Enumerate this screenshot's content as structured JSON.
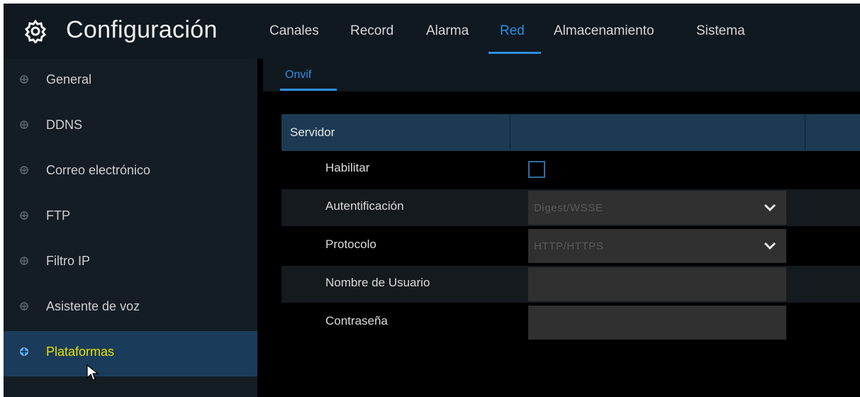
{
  "header": {
    "title": "Configuración",
    "icon": "gear-icon",
    "tabs": [
      {
        "label": "Canales",
        "active": false
      },
      {
        "label": "Record",
        "active": false
      },
      {
        "label": "Alarma",
        "active": false
      },
      {
        "label": "Red",
        "active": true
      },
      {
        "label": "Almacenamiento",
        "active": false
      },
      {
        "label": "Sistema",
        "active": false
      }
    ]
  },
  "sidebar": {
    "items": [
      {
        "label": "General",
        "active": false
      },
      {
        "label": "DDNS",
        "active": false
      },
      {
        "label": "Correo electrónico",
        "active": false
      },
      {
        "label": "FTP",
        "active": false
      },
      {
        "label": "Filtro IP",
        "active": false
      },
      {
        "label": "Asistente de voz",
        "active": false
      },
      {
        "label": "Plataformas",
        "active": true
      }
    ]
  },
  "subtabs": [
    {
      "label": "Onvif",
      "active": true
    }
  ],
  "form": {
    "section_header": "Servidor",
    "fields": {
      "enable": {
        "label": "Habilitar",
        "checked": false
      },
      "authentication": {
        "label": "Autentificación",
        "value": "Digest/WSSE"
      },
      "protocol": {
        "label": "Protocolo",
        "value": "HTTP/HTTPS"
      },
      "username": {
        "label": "Nombre de Usuario",
        "value": ""
      },
      "password": {
        "label": "Contraseña",
        "value": ""
      }
    }
  },
  "colors": {
    "accent": "#2f8fe0",
    "active_sidebar_text": "#e8e000",
    "active_sidebar_bg": "#1a3c5a",
    "background": "#000000"
  }
}
